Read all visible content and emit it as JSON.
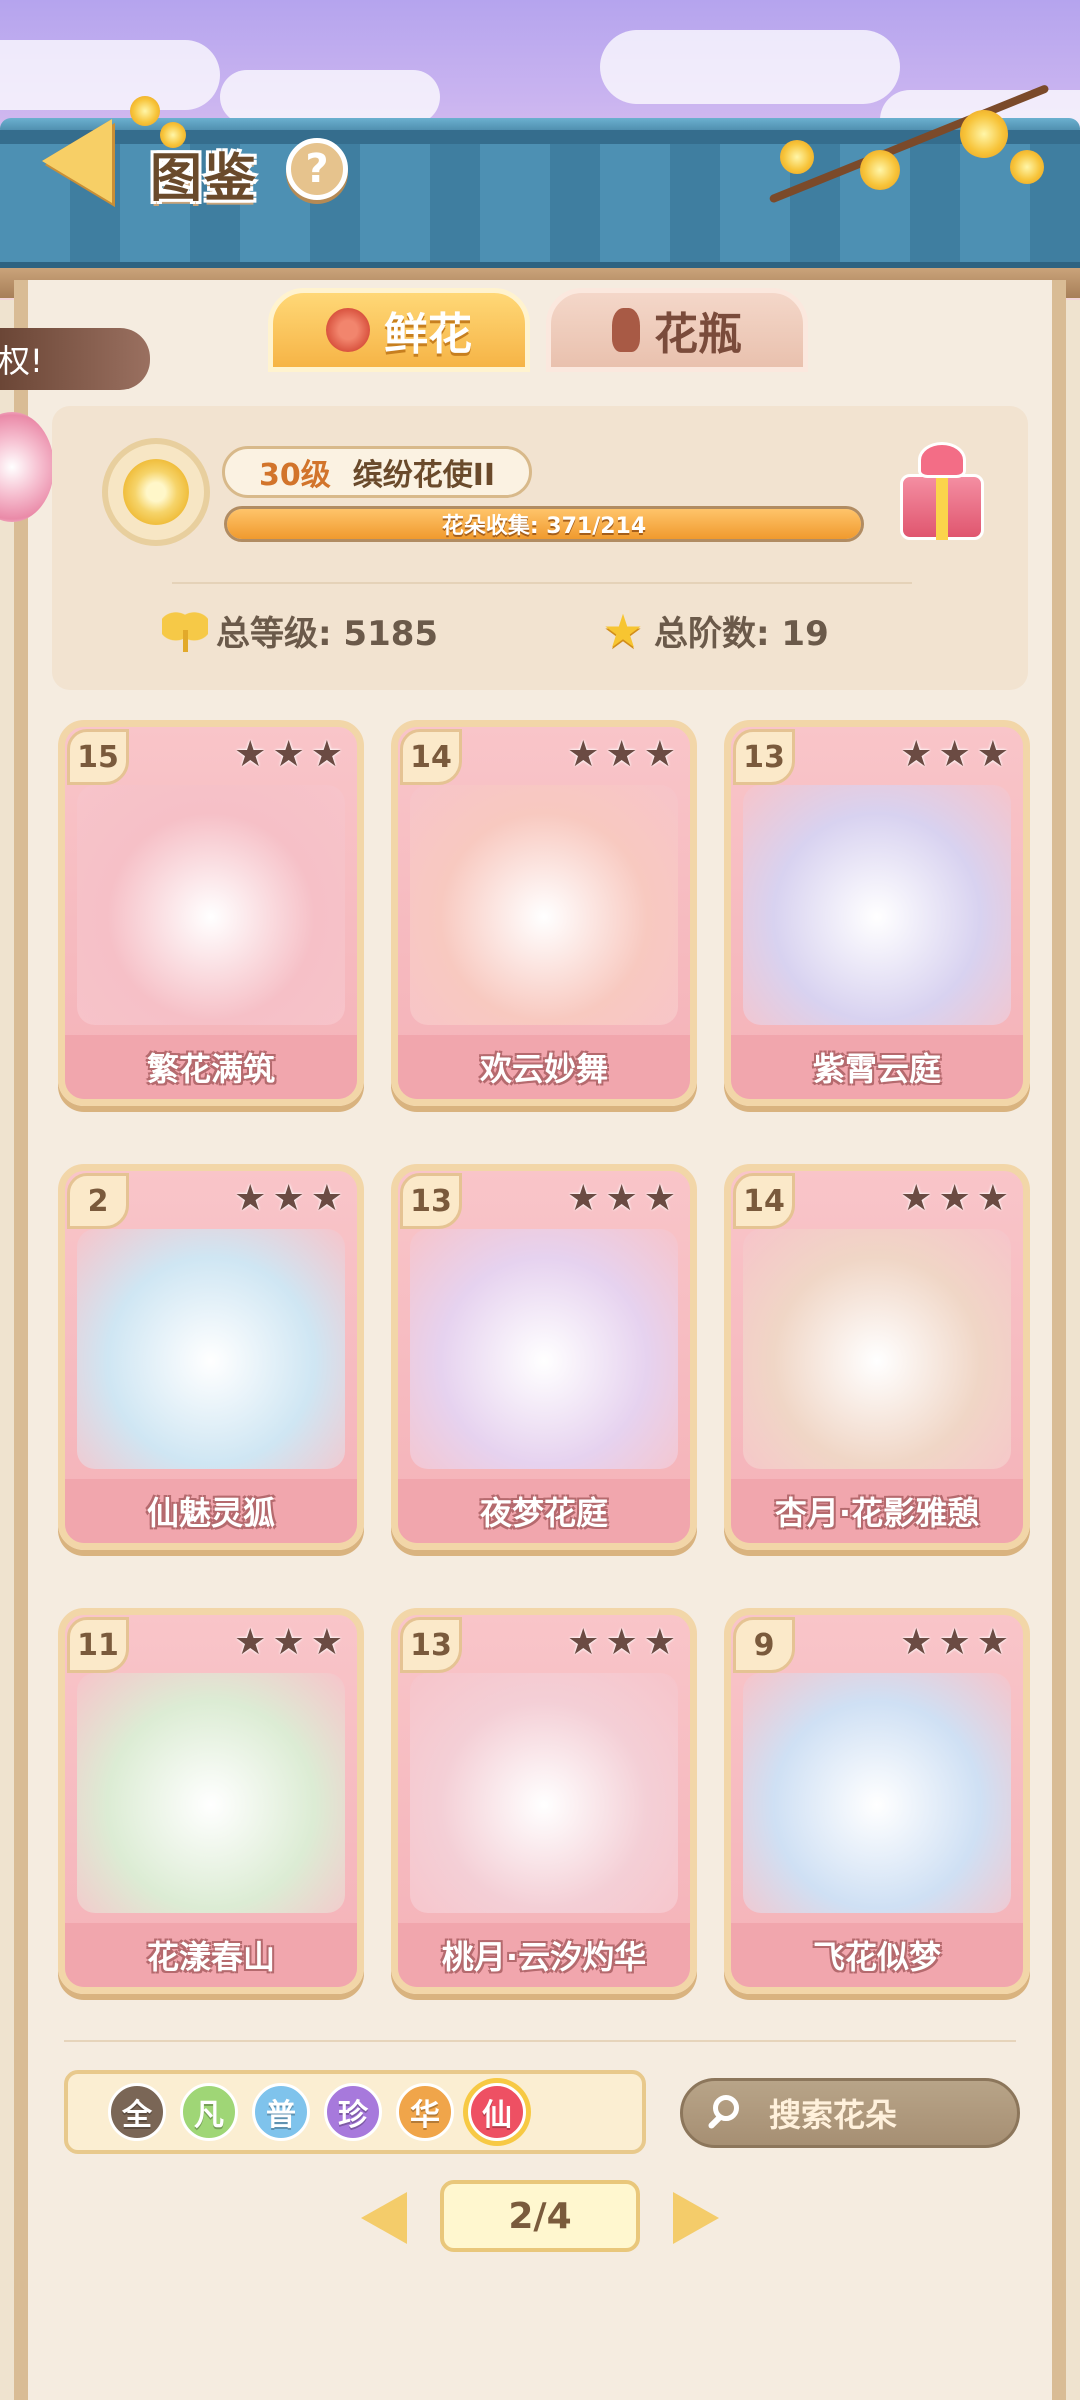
{
  "header": {
    "title": "图鉴",
    "help_label": "?"
  },
  "tabs": [
    {
      "label": "鲜花",
      "active": true
    },
    {
      "label": "花瓶",
      "active": false
    }
  ],
  "privilege_banner": "特权!",
  "stats": {
    "level": "30级",
    "level_title": "缤纷花使II",
    "collection_label": "花朵收集: 371/214",
    "collection_progress": 1.0,
    "total_level_label": "总等级: 5185",
    "total_stage_label": "总阶数: 19"
  },
  "cards": [
    {
      "level": "15",
      "name": "繁花满筑",
      "stars": 3,
      "art_color": "#f6c0c7"
    },
    {
      "level": "14",
      "name": "欢云妙舞",
      "stars": 3,
      "art_color": "#f8c9c0"
    },
    {
      "level": "13",
      "name": "紫霄云庭",
      "stars": 3,
      "art_color": "#d8d2f0"
    },
    {
      "level": "2",
      "name": "仙魅灵狐",
      "stars": 3,
      "art_color": "#cfe6f3"
    },
    {
      "level": "13",
      "name": "夜梦花庭",
      "stars": 3,
      "art_color": "#e6d2ef"
    },
    {
      "level": "14",
      "name": "杏月·花影雅憩",
      "stars": 3,
      "art_color": "#f0d6c6"
    },
    {
      "level": "11",
      "name": "花漾春山",
      "stars": 3,
      "art_color": "#dcecd4"
    },
    {
      "level": "13",
      "name": "桃月·云汐灼华",
      "stars": 3,
      "art_color": "#f4cfd6"
    },
    {
      "level": "9",
      "name": "飞花似梦",
      "stars": 3,
      "art_color": "#cfe0f4"
    }
  ],
  "rarity_filters": [
    {
      "label": "全",
      "color": "#7a6656",
      "selected": false
    },
    {
      "label": "凡",
      "color": "#9fd676",
      "selected": false
    },
    {
      "label": "普",
      "color": "#7fc3ec",
      "selected": false
    },
    {
      "label": "珍",
      "color": "#a779dc",
      "selected": false
    },
    {
      "label": "华",
      "color": "#f0a54a",
      "selected": false
    },
    {
      "label": "仙",
      "color": "#ee5063",
      "selected": true
    }
  ],
  "search": {
    "placeholder": "搜索花朵"
  },
  "pagination": {
    "current": "2/4"
  }
}
